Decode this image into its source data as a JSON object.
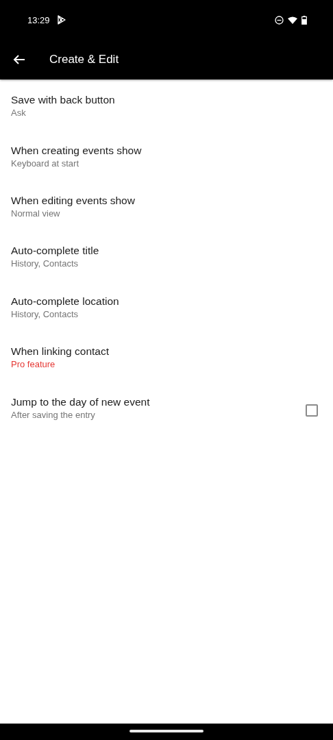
{
  "status_bar": {
    "time": "13:29"
  },
  "toolbar": {
    "title": "Create & Edit"
  },
  "settings": [
    {
      "kind": "select",
      "title": "Save with back button",
      "summary": "Ask",
      "pro": false
    },
    {
      "kind": "select",
      "title": "When creating events show",
      "summary": "Keyboard at start",
      "pro": false
    },
    {
      "kind": "select",
      "title": "When editing events show",
      "summary": "Normal view",
      "pro": false
    },
    {
      "kind": "select",
      "title": "Auto-complete title",
      "summary": "History, Contacts",
      "pro": false
    },
    {
      "kind": "select",
      "title": "Auto-complete location",
      "summary": "History, Contacts",
      "pro": false
    },
    {
      "kind": "select",
      "title": "When linking contact",
      "summary": "Pro feature",
      "pro": true
    },
    {
      "kind": "checkbox",
      "title": "Jump to the day of new event",
      "summary": "After saving the entry",
      "pro": false,
      "checked": false
    }
  ]
}
